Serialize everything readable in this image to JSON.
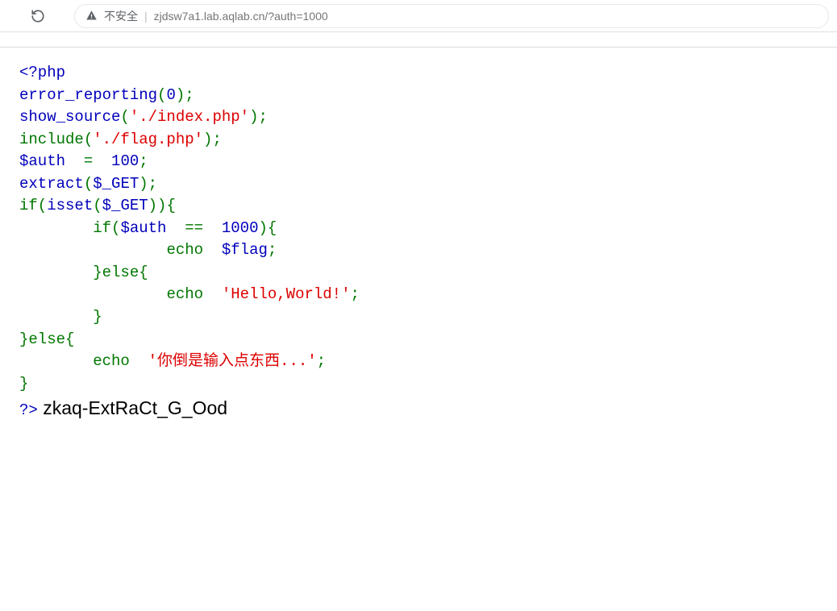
{
  "toolbar": {
    "insecure_label": "不安全",
    "url": "zjdsw7a1.lab.aqlab.cn/?auth=1000"
  },
  "code": {
    "l01_open": "<?php",
    "l02_fn": "error_reporting",
    "l02_p1": "(",
    "l02_arg": "0",
    "l02_p2": ");",
    "l03_fn": "show_source",
    "l03_p1": "(",
    "l03_arg": "'./index.php'",
    "l03_p2": ");",
    "l04_kw": "include(",
    "l04_arg": "'./flag.php'",
    "l04_p2": ");",
    "l05_var": "$auth  ",
    "l05_eq": "=  ",
    "l05_val": "100",
    "l05_semi": ";",
    "l06_fn": "extract",
    "l06_p1": "(",
    "l06_arg": "$_GET",
    "l06_p2": ");",
    "l07_if": "if(",
    "l07_isset": "isset",
    "l07_p1": "(",
    "l07_arg": "$_GET",
    "l07_p2": ")){",
    "l08_indent": "        ",
    "l08_if": "if(",
    "l08_var": "$auth  ",
    "l08_eq": "==  ",
    "l08_val": "1000",
    "l08_p2": "){",
    "l09_indent": "                ",
    "l09_echo": "echo  ",
    "l09_var": "$flag",
    "l09_semi": ";",
    "l10_indent": "        ",
    "l10_else": "}else{",
    "l11_indent": "                ",
    "l11_echo": "echo  ",
    "l11_str": "'Hello,World!'",
    "l11_semi": ";",
    "l12_indent": "        ",
    "l12_close": "}",
    "l13_else": "}else{",
    "l14_indent": "        ",
    "l14_echo": "echo  ",
    "l14_str": "'你倒是输入点东西...'",
    "l14_semi": ";",
    "l15_close": "}",
    "l16_close": "?>",
    "output": " zkaq-ExtRaCt_G_Ood"
  }
}
